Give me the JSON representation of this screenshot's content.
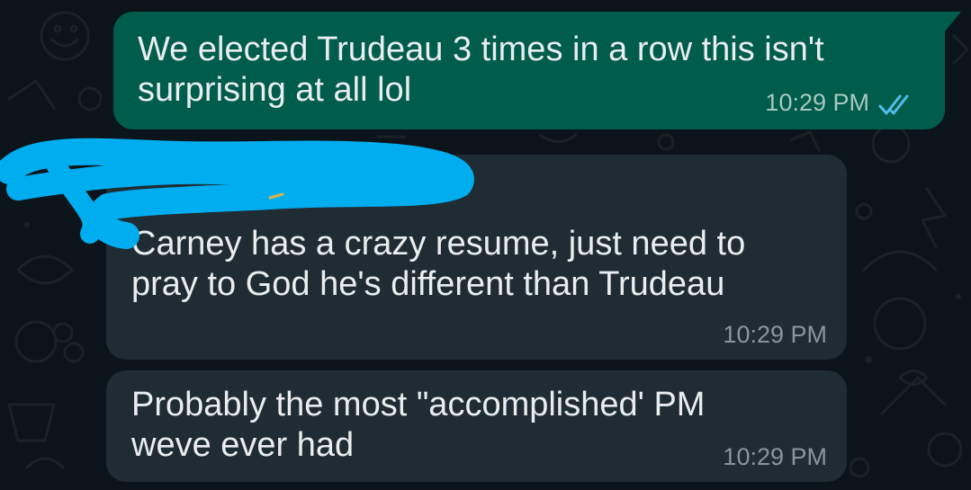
{
  "conversation": {
    "messages": [
      {
        "direction": "outgoing",
        "text": "We elected Trudeau 3 times in a row this isn't\nsurprising at all lol",
        "time": "10:29 PM",
        "status_icon": "double-check-read-icon"
      },
      {
        "direction": "incoming",
        "sender": "",
        "sender_redacted": true,
        "text": "Carney has a crazy resume, just need to\npray to God he's different than Trudeau",
        "time": "10:29 PM"
      },
      {
        "direction": "incoming",
        "text": "Probably the most \"accomplished' PM\nweve ever had",
        "time": "10:29 PM"
      }
    ]
  },
  "colors": {
    "background": "#0b141a",
    "outgoing_bubble": "#005c4b",
    "incoming_bubble": "#202c33",
    "text": "#e9edef",
    "read_ticks": "#53bdeb",
    "redaction_scribble": "#00aeef"
  }
}
